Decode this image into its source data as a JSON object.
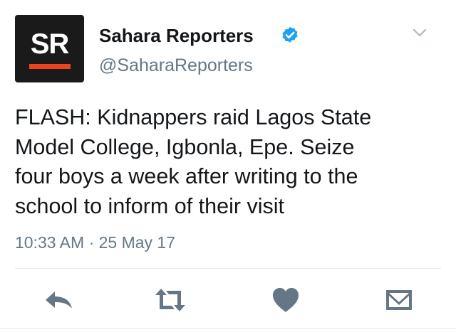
{
  "author": {
    "display_name": "Sahara Reporters",
    "handle": "@SaharaReporters",
    "avatar_initials": "SR",
    "verified": true
  },
  "tweet": {
    "text_lines": [
      "FLASH: Kidnappers raid Lagos State",
      "Model College, Igbonla, Epe. Seize",
      "four boys a week after writing to the",
      "school to inform of their visit"
    ],
    "timestamp": "10:33 AM · 25 May 17"
  },
  "actions": [
    {
      "name": "reply",
      "icon": "reply-icon"
    },
    {
      "name": "retweet",
      "icon": "retweet-icon"
    },
    {
      "name": "like",
      "icon": "heart-icon"
    },
    {
      "name": "direct-message",
      "icon": "envelope-icon"
    }
  ],
  "colors": {
    "text": "#14171a",
    "secondary": "#657786",
    "verified_blue": "#1da1f2",
    "icon_gray": "#657786",
    "avatar_bg": "#1a1a1a",
    "avatar_accent": "#e8461a",
    "divider": "#e1e8ed"
  }
}
